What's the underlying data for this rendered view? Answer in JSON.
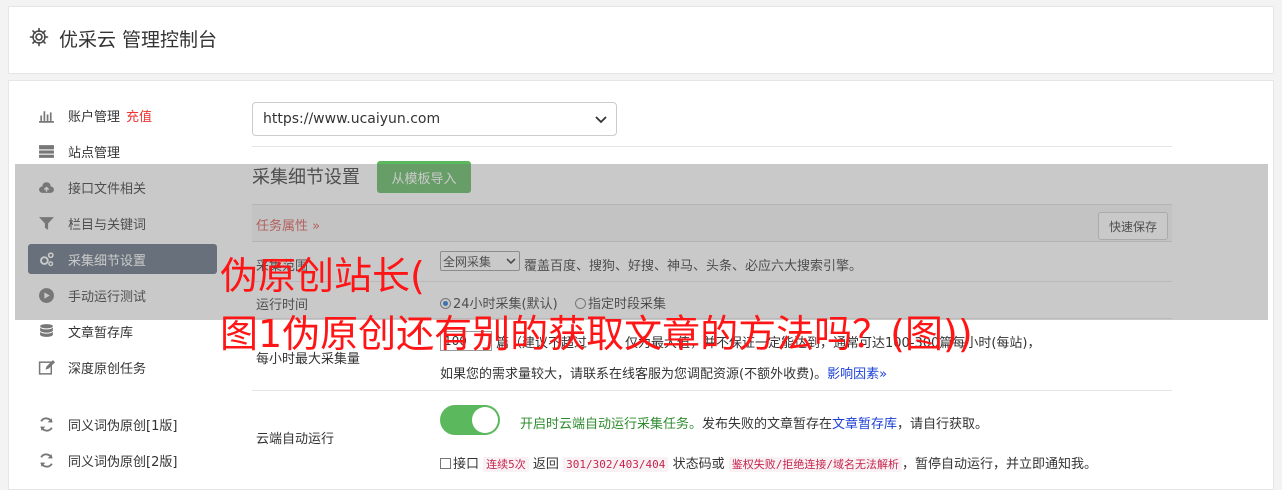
{
  "header": {
    "title": "优采云 管理控制台",
    "icon": "gear-icon"
  },
  "sidebar": {
    "items": [
      {
        "label": "账户管理",
        "extra": "充值",
        "icon": "bar-chart-icon"
      },
      {
        "label": "站点管理",
        "icon": "server-icon"
      },
      {
        "label": "接口文件相关",
        "icon": "cloud-upload-icon"
      },
      {
        "label": "栏目与关键词",
        "icon": "filter-icon"
      },
      {
        "label": "采集细节设置",
        "icon": "cogs-icon",
        "active": true
      },
      {
        "label": "手动运行测试",
        "icon": "play-circle-icon"
      },
      {
        "label": "文章暂存库",
        "icon": "database-icon"
      },
      {
        "label": "深度原创任务",
        "icon": "edit-icon"
      },
      {
        "label": "同义词伪原创[1版]",
        "icon": "refresh-icon"
      },
      {
        "label": "同义词伪原创[2版]",
        "icon": "refresh-icon"
      }
    ]
  },
  "site_select": {
    "value": "https://www.ucaiyun.com"
  },
  "section": {
    "title": "采集细节设置",
    "import_button": "从模板导入"
  },
  "task_header": {
    "label": "任务属性",
    "save_button": "快速保存"
  },
  "rows": {
    "scope": {
      "label": "采集范围",
      "select_value": "全网采集",
      "desc": "覆盖百度、搜狗、好搜、神马、头条、必应六大搜索引擎。"
    },
    "runtime": {
      "label": "运行时间",
      "option1": "24小时采集(默认)",
      "option2": "指定时段采集"
    },
    "max": {
      "label": "每小时最大采集量",
      "value": "100",
      "line1_a": "篇（建议不超过",
      "line1_b": "仅为最大值，并不保证一定能达到，通常可达100-300篇每小时(每站)，",
      "line2": "如果您的需求量较大，请联系在线客服为您调配资源(不额外收费)。",
      "link": "影响因素"
    },
    "cloud": {
      "label": "云端自动运行",
      "toggle_on": true,
      "desc_green": "开启时云端自动运行采集任务。",
      "desc_a": "发布失败的文章暂存在",
      "desc_link": "文章暂存库",
      "desc_b": "，请自行获取。",
      "check_label": "接口",
      "code1": "连续5次",
      "txt1": "返回",
      "code2": "301/302/403/404",
      "txt2": "状态码或",
      "code3": "鉴权失败/拒绝连接/域名无法解析",
      "txt3": "，暂停自动运行，并立即通知我。"
    }
  },
  "watermark": {
    "line1": "伪原创站长(",
    "line2": "图1伪原创还有别的获取文章的方法吗？(图))"
  },
  "colors": {
    "accent_green": "#5cb85c",
    "active_bg": "#5e6d7e",
    "red": "#ff1515"
  }
}
